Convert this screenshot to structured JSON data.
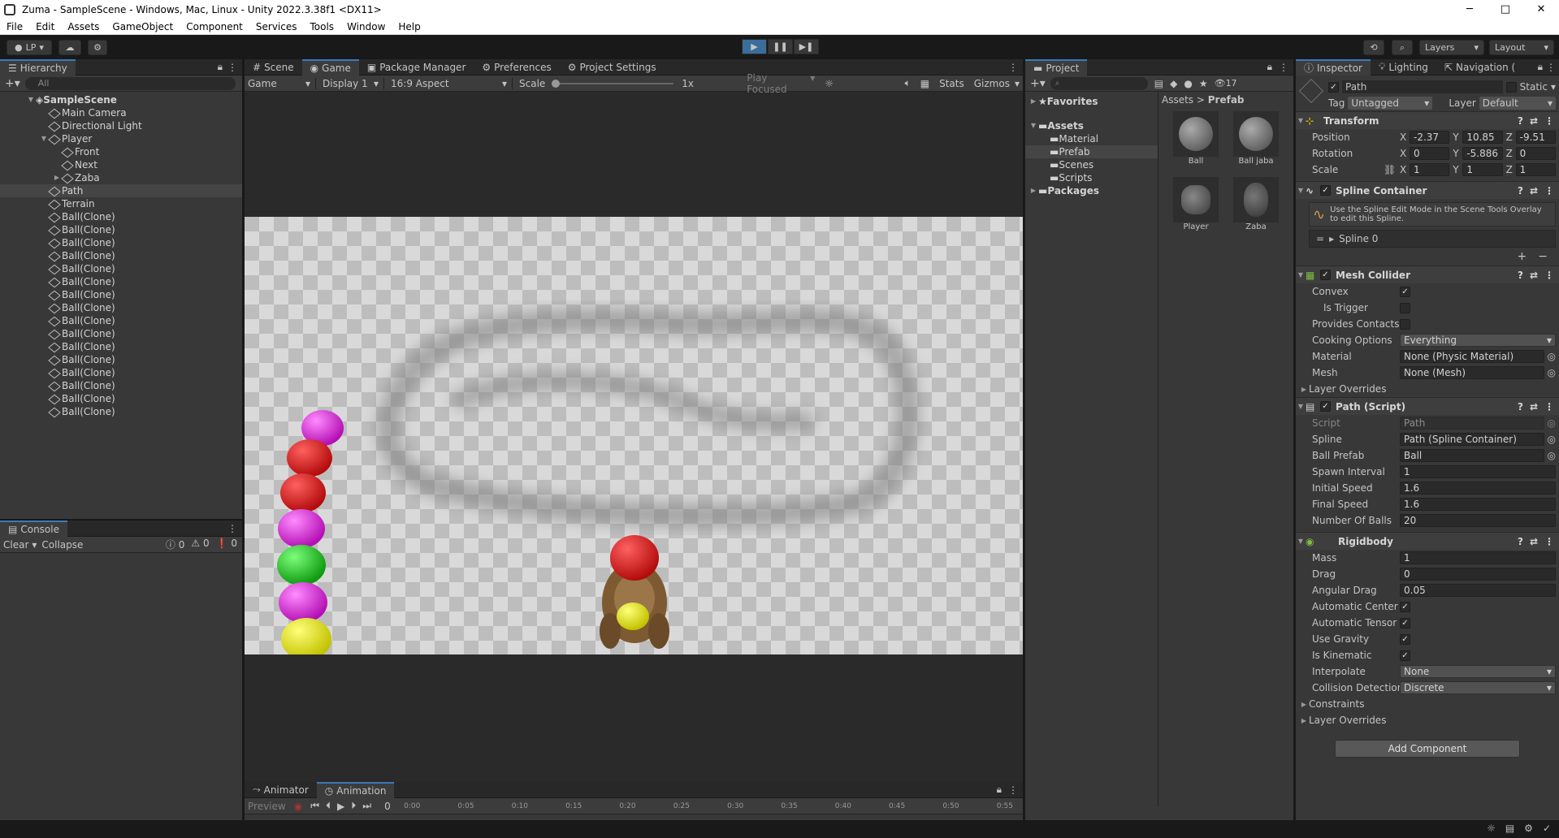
{
  "window": {
    "title": "Zuma - SampleScene - Windows, Mac, Linux - Unity 2022.3.38f1 <DX11>",
    "min": "─",
    "max": "□",
    "close": "✕"
  },
  "menu": [
    "File",
    "Edit",
    "Assets",
    "GameObject",
    "Component",
    "Services",
    "Tools",
    "Window",
    "Help"
  ],
  "toolbar": {
    "account": "LP",
    "layers": "Layers",
    "layout": "Layout"
  },
  "hierarchy": {
    "tab": "Hierarchy",
    "search": "All",
    "scene": "SampleScene",
    "items": [
      "Main Camera",
      "Directional Light",
      "Player",
      "Front",
      "Next",
      "Zaba",
      "Path",
      "Terrain",
      "Ball(Clone)",
      "Ball(Clone)",
      "Ball(Clone)",
      "Ball(Clone)",
      "Ball(Clone)",
      "Ball(Clone)",
      "Ball(Clone)",
      "Ball(Clone)",
      "Ball(Clone)",
      "Ball(Clone)",
      "Ball(Clone)",
      "Ball(Clone)",
      "Ball(Clone)",
      "Ball(Clone)",
      "Ball(Clone)",
      "Ball(Clone)"
    ]
  },
  "console": {
    "tab": "Console",
    "clear": "Clear",
    "collapse": "Collapse",
    "c1": "0",
    "c2": "0",
    "c3": "0"
  },
  "center": {
    "tabs": [
      "Scene",
      "Game",
      "Package Manager",
      "Preferences",
      "Project Settings"
    ],
    "game": "Game",
    "display": "Display 1",
    "aspect": "16:9 Aspect",
    "scale": "Scale",
    "scale_val": "1x",
    "play_focused": "Play Focused",
    "stats": "Stats",
    "gizmos": "Gizmos"
  },
  "bottom": {
    "tabs": [
      "Animator",
      "Animation"
    ],
    "preview": "Preview",
    "frame": "0",
    "ticks": [
      "0:00",
      "0:05",
      "0:10",
      "0:15",
      "0:20",
      "0:25",
      "0:30",
      "0:35",
      "0:40",
      "0:45",
      "0:50",
      "0:55"
    ]
  },
  "project": {
    "tab": "Project",
    "count": "17",
    "favorites": "Favorites",
    "assets": "Assets",
    "folders": [
      "Material",
      "Prefab",
      "Scenes",
      "Scripts"
    ],
    "packages": "Packages",
    "crumb1": "Assets",
    "crumb2": "Prefab",
    "files": [
      "Ball",
      "Ball jaba",
      "Player",
      "Zaba"
    ]
  },
  "inspector": {
    "tabs": [
      "Inspector",
      "Lighting",
      "Navigation ("
    ],
    "object": "Path",
    "static": "Static",
    "tag_lbl": "Tag",
    "tag": "Untagged",
    "layer_lbl": "Layer",
    "layer": "Default",
    "transform": {
      "title": "Transform",
      "position": "Position",
      "rotation": "Rotation",
      "scale": "Scale",
      "px": "-2.37",
      "py": "10.85",
      "pz": "-9.51",
      "rx": "0",
      "ry": "-5.886",
      "rz": "0",
      "sx": "1",
      "sy": "1",
      "sz": "1"
    },
    "spline": {
      "title": "Spline Container",
      "help": "Use the Spline Edit Mode in the Scene Tools Overlay to edit this Spline.",
      "item": "Spline 0"
    },
    "mesh": {
      "title": "Mesh Collider",
      "convex": "Convex",
      "trigger": "Is Trigger",
      "contacts": "Provides Contacts",
      "cooking": "Cooking Options",
      "cooking_val": "Everything",
      "material": "Material",
      "material_val": "None (Physic Material)",
      "mesh": "Mesh",
      "mesh_val": "None (Mesh)",
      "overrides": "Layer Overrides"
    },
    "path": {
      "title": "Path (Script)",
      "script": "Script",
      "script_val": "Path",
      "spline": "Spline",
      "spline_val": "Path (Spline Container)",
      "prefab": "Ball Prefab",
      "prefab_val": "Ball",
      "spawn": "Spawn Interval",
      "spawn_val": "1",
      "initial": "Initial Speed",
      "initial_val": "1.6",
      "final": "Final Speed",
      "final_val": "1.6",
      "balls": "Number Of Balls",
      "balls_val": "20"
    },
    "rb": {
      "title": "Rigidbody",
      "mass": "Mass",
      "mass_val": "1",
      "drag": "Drag",
      "drag_val": "0",
      "adrag": "Angular Drag",
      "adrag_val": "0.05",
      "aco": "Automatic Center Of I",
      "at": "Automatic Tensor",
      "grav": "Use Gravity",
      "kin": "Is Kinematic",
      "interp": "Interpolate",
      "interp_val": "None",
      "coll": "Collision Detection",
      "coll_val": "Discrete",
      "constraints": "Constraints",
      "overrides": "Layer Overrides"
    },
    "add": "Add Component"
  },
  "colors": {
    "accent": "#3a79bb",
    "panel": "#383838",
    "ball_magenta": "#d21ad2",
    "ball_red": "#d11414",
    "ball_green": "#1ec21e",
    "ball_yellow": "#e3e30b"
  }
}
